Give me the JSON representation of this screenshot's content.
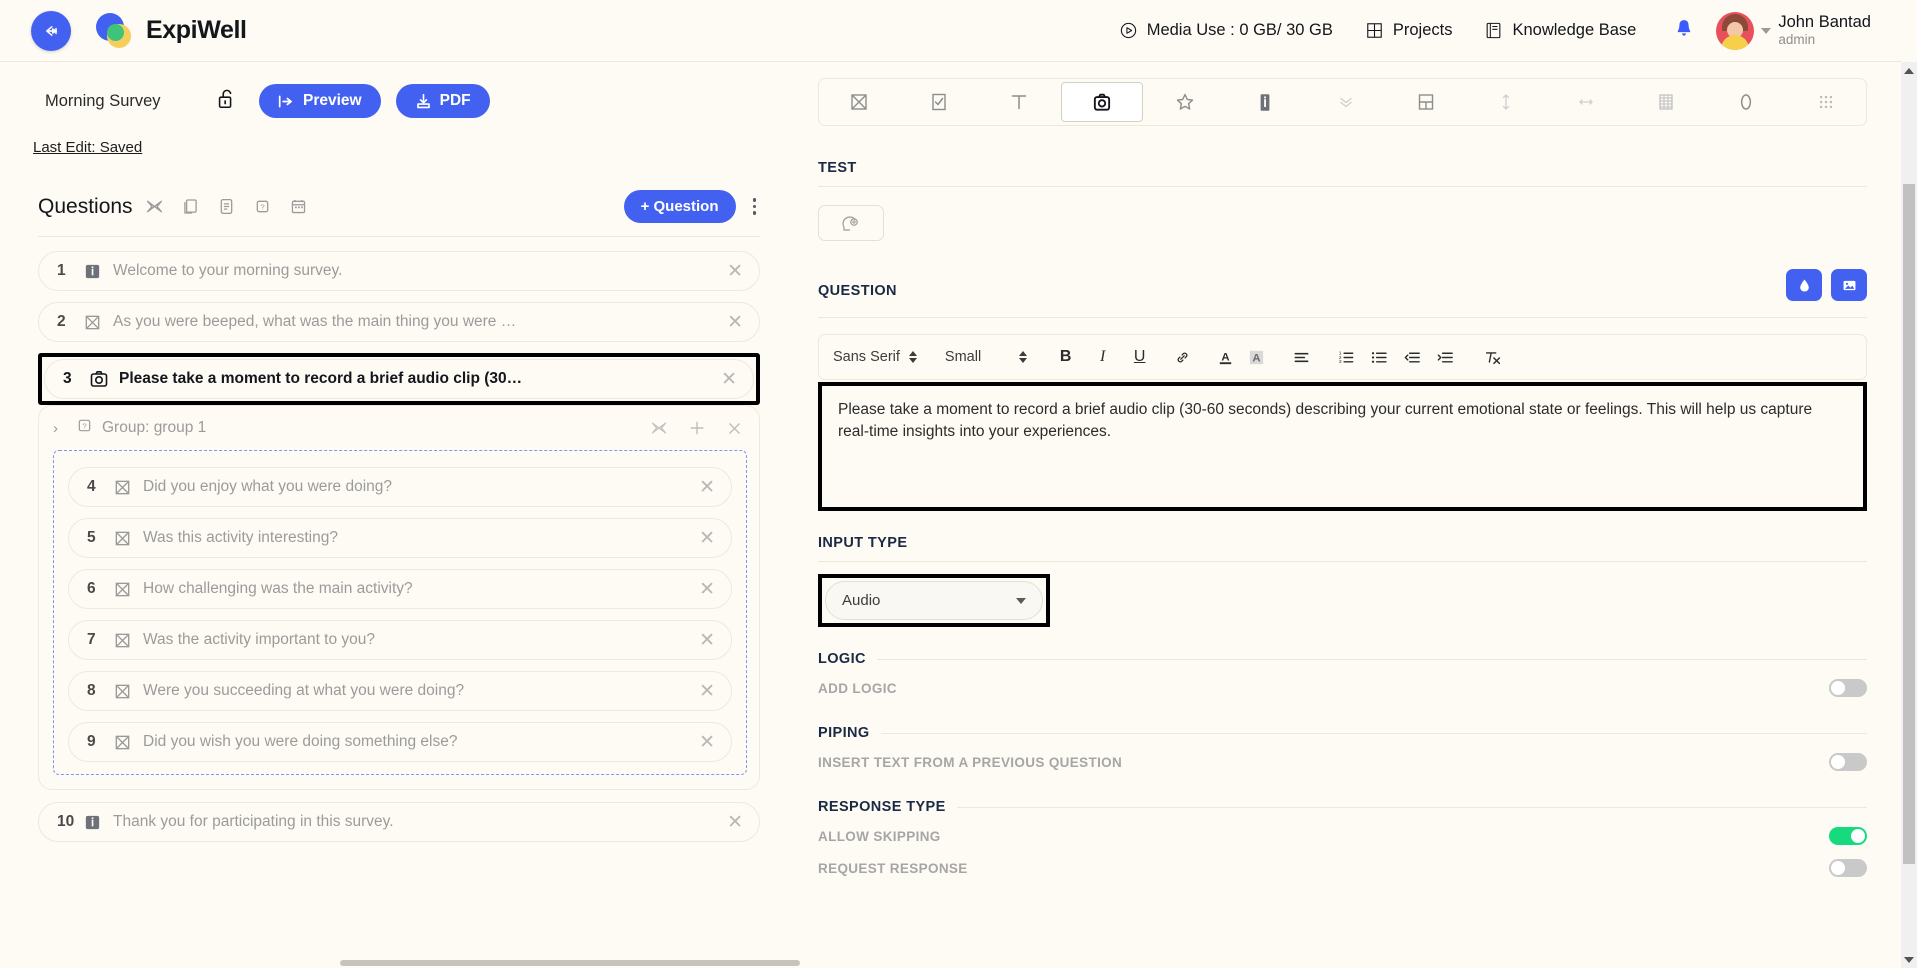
{
  "brand": {
    "name": "ExpiWell",
    "accent": "#4361f0",
    "bg": "#fdfbf3"
  },
  "topbar": {
    "back_label": "Back",
    "media_use": "Media Use : 0 GB/ 30 GB",
    "projects": "Projects",
    "knowledge_base": "Knowledge Base",
    "user_name": "John Bantad",
    "user_role": "admin"
  },
  "survey": {
    "title": "Morning Survey",
    "preview_label": "Preview",
    "pdf_label": "PDF",
    "last_edit": "Last Edit: Saved"
  },
  "questions_panel": {
    "heading": "Questions",
    "add_button": "+ Question",
    "header_icons": [
      "shuffle-icon",
      "copy-icon",
      "document-icon",
      "help-icon",
      "calendar-icon"
    ],
    "items": [
      {
        "num": "1",
        "icon": "info-icon",
        "text": "Welcome to your morning survey.",
        "selected": false
      },
      {
        "num": "2",
        "icon": "multiple-choice-icon",
        "text": "As you were beeped, what was the main thing you were …",
        "selected": false
      },
      {
        "num": "3",
        "icon": "camera-icon",
        "text": "Please take a moment to record a brief audio clip (30…",
        "selected": true
      }
    ],
    "group": {
      "label": "Group: group 1",
      "icon": "help-icon",
      "actions": [
        "shuffle-icon",
        "plus-icon",
        "close-icon"
      ],
      "items": [
        {
          "num": "4",
          "icon": "multiple-choice-icon",
          "text": "Did you enjoy what you were doing?"
        },
        {
          "num": "5",
          "icon": "multiple-choice-icon",
          "text": "Was this activity interesting?"
        },
        {
          "num": "6",
          "icon": "multiple-choice-icon",
          "text": "How challenging was the main activity?"
        },
        {
          "num": "7",
          "icon": "multiple-choice-icon",
          "text": "Was the activity important to you?"
        },
        {
          "num": "8",
          "icon": "multiple-choice-icon",
          "text": "Were you succeeding at what you were doing?"
        },
        {
          "num": "9",
          "icon": "multiple-choice-icon",
          "text": "Did you wish you were doing something else?"
        }
      ]
    },
    "items_after": [
      {
        "num": "10",
        "icon": "info-icon",
        "text": "Thank you for participating in this survey.",
        "selected": false
      }
    ]
  },
  "editor_panel": {
    "type_toolbar": [
      {
        "name": "multiple-choice-icon",
        "active": false
      },
      {
        "name": "checkbox-icon",
        "active": false
      },
      {
        "name": "text-icon",
        "active": false
      },
      {
        "name": "camera-icon",
        "active": true
      },
      {
        "name": "star-rating-icon",
        "active": false
      },
      {
        "name": "info-icon",
        "active": false
      },
      {
        "name": "chevrons-down-icon",
        "active": false
      },
      {
        "name": "grid-layout-icon",
        "active": false
      },
      {
        "name": "vertical-slider-icon",
        "active": false
      },
      {
        "name": "horizontal-slider-icon",
        "active": false
      },
      {
        "name": "matrix-icon",
        "active": false
      },
      {
        "name": "clock-icon",
        "active": false
      },
      {
        "name": "keypad-icon",
        "active": false
      }
    ],
    "test_section": {
      "title": "TEST",
      "button_icon": "brain-gear-icon"
    },
    "question_section": {
      "title": "QUESTION",
      "buttons": [
        "ink-drop-icon",
        "image-icon"
      ],
      "toolbar": {
        "font_family": "Sans Serif",
        "font_size": "Small",
        "bold": "B",
        "italic": "I",
        "underline": "U",
        "link": "link-icon",
        "text_color": "A",
        "highlight": "A",
        "align": "align-icon",
        "ordered_list": "ordered-list-icon",
        "bullet_list": "bullet-list-icon",
        "outdent": "outdent-icon",
        "indent": "indent-icon",
        "clear_format": "clear-format-icon"
      },
      "body_text": "Please take a moment to record a brief audio clip (30-60 seconds) describing your current emotional state or feelings. This will help us capture real-time insights into your experiences."
    },
    "input_type": {
      "title": "INPUT TYPE",
      "value": "Audio"
    },
    "logic": {
      "title": "LOGIC",
      "row_label": "ADD LOGIC",
      "enabled": false
    },
    "piping": {
      "title": "PIPING",
      "row_label": "INSERT TEXT FROM A PREVIOUS QUESTION",
      "enabled": false
    },
    "response_type": {
      "title": "RESPONSE TYPE",
      "rows": [
        {
          "label": "ALLOW SKIPPING",
          "enabled": true
        },
        {
          "label": "REQUEST RESPONSE",
          "enabled": false
        }
      ]
    }
  }
}
